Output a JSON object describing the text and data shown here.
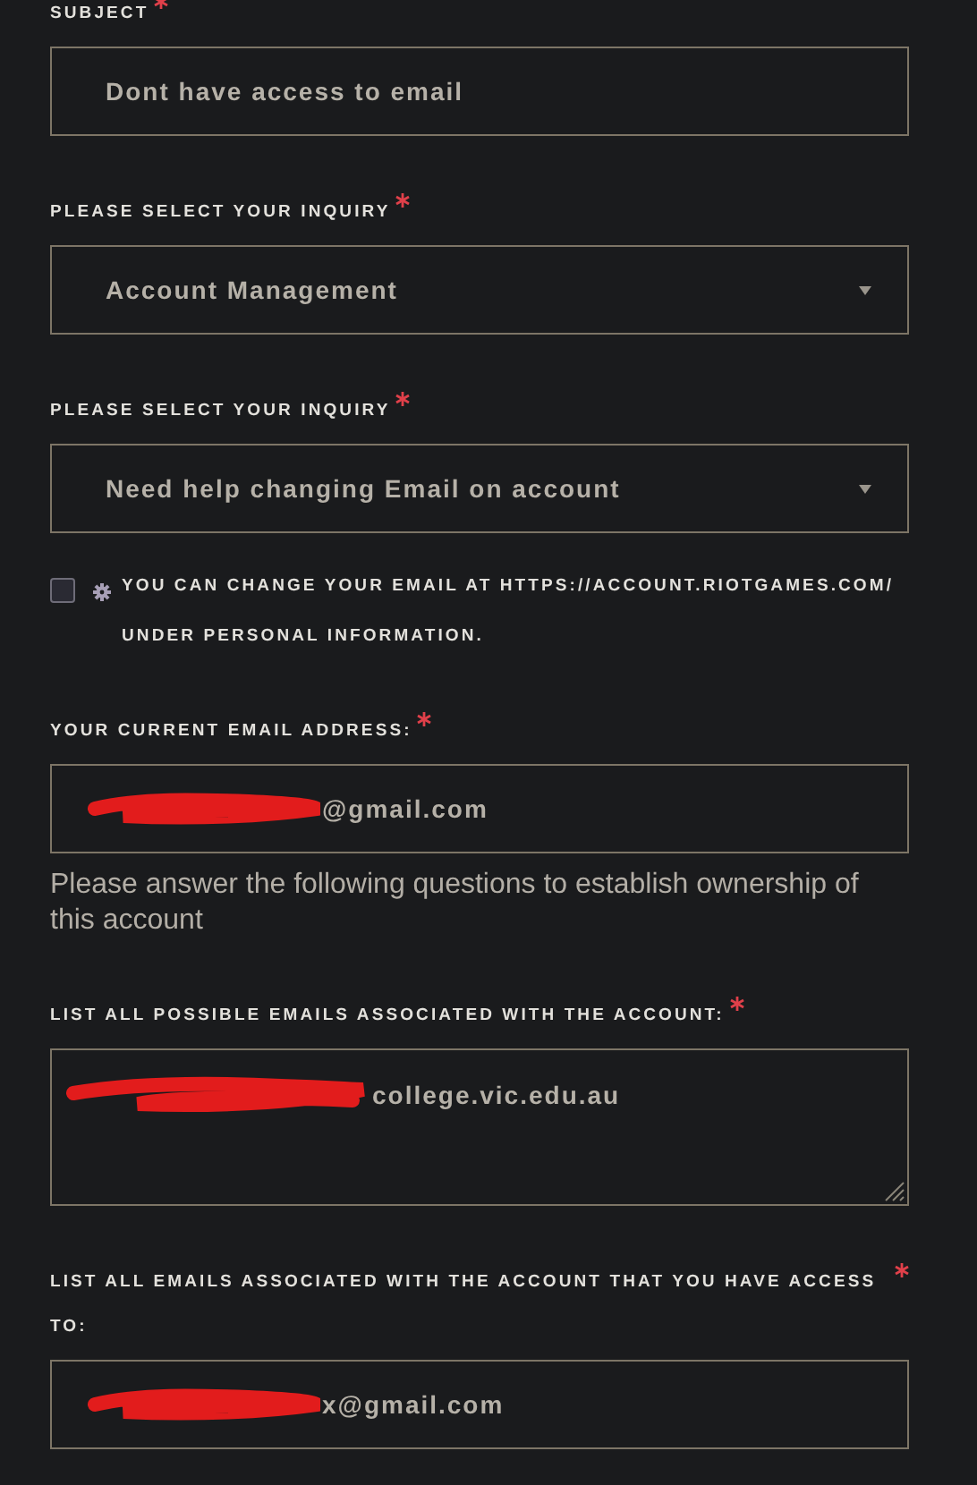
{
  "form": {
    "items": [
      {
        "kind": "text",
        "label": "SUBJECT",
        "required": true,
        "value": "Dont have access to email"
      },
      {
        "kind": "select",
        "label": "PLEASE SELECT YOUR INQUIRY",
        "required": true,
        "value": "Account Management"
      },
      {
        "kind": "select",
        "label": "PLEASE SELECT YOUR INQUIRY",
        "required": true,
        "value": "Need help changing Email on account"
      },
      {
        "kind": "checkbox",
        "checked": false,
        "text": "YOU CAN CHANGE YOUR EMAIL AT HTTPS://ACCOUNT.RIOTGAMES.COM/ UNDER PERSONAL INFORMATION."
      },
      {
        "kind": "text",
        "label": "YOUR CURRENT EMAIL ADDRESS:",
        "required": true,
        "redacted": true,
        "value": "@gmail.com"
      },
      {
        "kind": "help",
        "text": "Please answer the following questions to establish ownership of this account"
      },
      {
        "kind": "textarea",
        "label": "LIST ALL POSSIBLE EMAILS ASSOCIATED WITH THE ACCOUNT:",
        "required": true,
        "redacted": true,
        "value": "college.vic.edu.au"
      },
      {
        "kind": "text",
        "label": "LIST ALL EMAILS ASSOCIATED WITH THE ACCOUNT THAT YOU HAVE ACCESS TO:",
        "required": true,
        "redacted": true,
        "value": "x@gmail.com"
      }
    ]
  }
}
